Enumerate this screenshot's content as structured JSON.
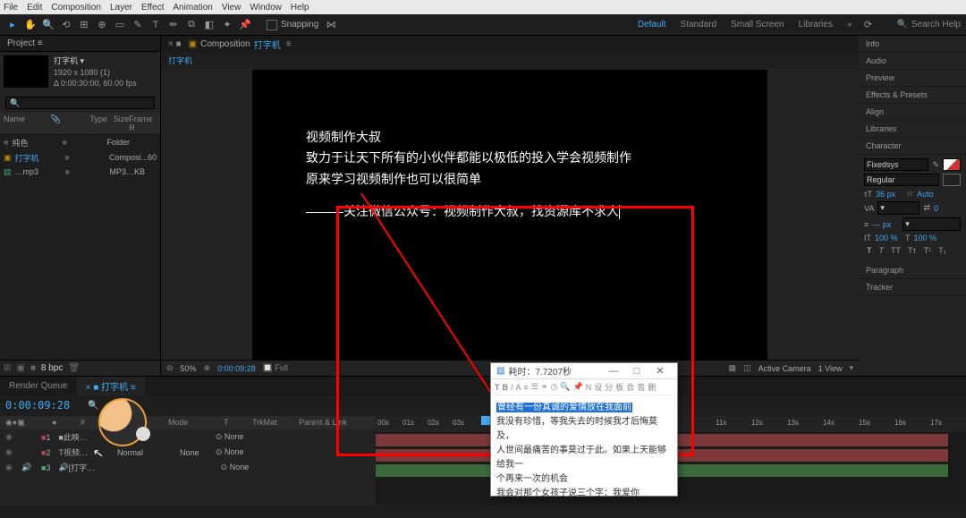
{
  "menu": {
    "file": "File",
    "edit": "Edit",
    "composition": "Composition",
    "layer": "Layer",
    "effect": "Effect",
    "animation": "Animation",
    "view": "View",
    "window": "Window",
    "help": "Help"
  },
  "toolbar": {
    "snapping": "Snapping",
    "ws_default": "Default",
    "ws_standard": "Standard",
    "ws_small": "Small Screen",
    "ws_libraries": "Libraries",
    "search": "Search Help"
  },
  "project": {
    "tab": "Project",
    "item_name": "打字机 ▾",
    "item_res": "1920 x 1080 (1)",
    "item_dur": "Δ 0:00:30:00, 60.00 fps",
    "col_name": "Name",
    "col_type": "Type",
    "col_size": "Size",
    "col_frame": "Frame R",
    "rows": [
      {
        "name": "纯色",
        "type": "Folder",
        "size": "",
        "kind": "folder"
      },
      {
        "name": "打字机",
        "type": "Composi...",
        "size": "60",
        "kind": "comp"
      },
      {
        "name": "…mp3",
        "type": "MP3",
        "size": "…KB",
        "kind": "audio"
      }
    ],
    "footer_bpc": "8 bpc"
  },
  "comp": {
    "tab_prefix": "Composition",
    "name": "打字机",
    "text1": "视频制作大叔",
    "text2": "致力于让天下所有的小伙伴都能以极低的投入学会视频制作",
    "text3": "原来学习视频制作也可以很简单",
    "text4": "———关注微信公众号：视频制作大叔，找资源库不求人",
    "zoom": "50%",
    "time": "0:00:09:28",
    "res": "Full",
    "camera": "Active Camera",
    "views": "1 View"
  },
  "right": {
    "info": "Info",
    "audio": "Audio",
    "preview": "Preview",
    "effects": "Effects & Presets",
    "align": "Align",
    "libraries": "Libraries",
    "character": "Character",
    "font": "Fixedsys",
    "style": "Regular",
    "size": "36 px",
    "auto": "Auto",
    "kern": "0",
    "stroke": "— px",
    "over": "▾",
    "pct1": "100 %",
    "pct2": "100 %",
    "paragraph": "Paragraph",
    "tracker": "Tracker"
  },
  "timeline": {
    "render_queue": "Render Queue",
    "comp_tab": "打字机",
    "timecode": "0:00:09:28",
    "col_layer": "Layer Name",
    "col_mode": "Mode",
    "col_trkmat": "TrkMat",
    "col_parent": "Parent & Link",
    "layers": [
      {
        "num": "1",
        "name": "此映…",
        "mode": "Normal",
        "trk": "",
        "parent": "None",
        "color": "#b44"
      },
      {
        "num": "2",
        "name": "视频…",
        "mode": "Normal",
        "trk": "None",
        "parent": "None",
        "color": "#b44"
      },
      {
        "num": "3",
        "name": "[打字…",
        "mode": "",
        "trk": "",
        "parent": "None",
        "color": "#4a7"
      }
    ],
    "ticks": [
      "00s",
      "01s",
      "02s",
      "03s",
      "",
      "11s",
      "12s",
      "13s",
      "14s",
      "15s",
      "16s",
      "17s"
    ]
  },
  "popup": {
    "title": "耗时：7.7207秒",
    "hl": "曾经有一份真诚的爱情放在我面前",
    "l2": "我没有珍惜，等我失去的时候我才后悔莫及，",
    "l3": "人世间最痛苦的事莫过于此。如果上天能够给我一",
    "l4": "个再来一次的机会",
    "l5": "我会对那个女孩子说三个字：我爱你"
  }
}
